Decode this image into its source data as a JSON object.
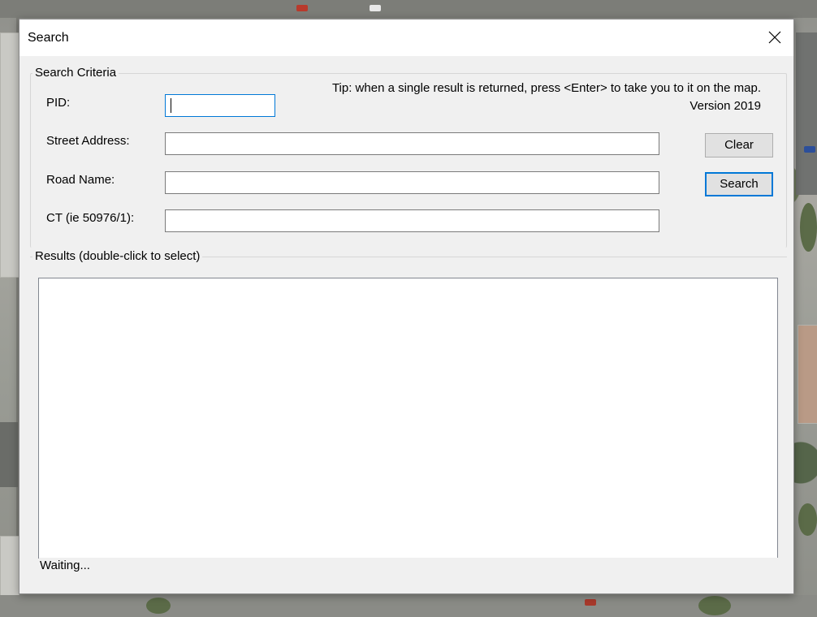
{
  "window": {
    "title": "Search",
    "close_icon": "close-icon"
  },
  "criteria": {
    "legend": "Search Criteria",
    "tip_line1": "Tip: when a single result is returned, press <Enter> to take you to it on the map.",
    "tip_line2": "Version 2019",
    "fields": {
      "pid": {
        "label": "PID:",
        "value": ""
      },
      "street_address": {
        "label": "Street Address:",
        "value": ""
      },
      "road_name": {
        "label": "Road Name:",
        "value": ""
      },
      "ct": {
        "label": "CT (ie 50976/1):",
        "value": ""
      }
    },
    "clear_label": "Clear",
    "search_label": "Search"
  },
  "results": {
    "legend": "Results (double-click to select)",
    "items": [],
    "status": "Waiting..."
  },
  "colors": {
    "focus_accent": "#0078d7",
    "dialog_bg": "#f0f0f0"
  }
}
